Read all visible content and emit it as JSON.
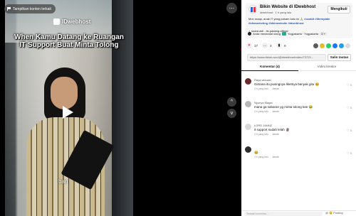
{
  "video": {
    "report_label": "Tampilkan konten terkait",
    "watermark": "IDwebhost",
    "caption_line1": "When Kamu Datang ke Ruangan",
    "caption_line2": "IT Support Buat Minta Tolong",
    "subtitle": "ban",
    "more_label": "...",
    "nav_up": "^",
    "nav_down": "v"
  },
  "account": {
    "name": "Bikin Website di IDwebhost",
    "handle": "idwebhost · 1 h yang lalu",
    "follow_label": "Mengikuti",
    "description_prefix": "Mon maap, anak IT yang paham kalo ini 🙏",
    "description_tags": "#ovabit #ittemplate #idemarketing #bikinwebsite #idwebhost",
    "music": "suara asli - itc.padang.official",
    "collab_label": "Anda menandai ulang",
    "location_label": "Yogyakarta · Yogyakarta",
    "plus_count": "3 +"
  },
  "actions": {
    "likes": "17",
    "comments": "3",
    "bookmarks": "0"
  },
  "link": {
    "url": "https://www.tiktok.com/@idwebhost/video/73723...",
    "copy_label": "Salin tautan"
  },
  "tabs": {
    "comments": "Komentar (4)",
    "creator_videos": "Video kreator"
  },
  "comments": [
    {
      "user": "Raya widuasi",
      "text": "Gimana itu pusingnya liketnya banyak gitu 😂",
      "time": "3 h yang lalu",
      "reply": "Jawab",
      "likes": "0"
    },
    {
      "user": "Nyonya Magel",
      "text": "mana ga sabaran yg minta tolong kan 😂",
      "time": "3 h yang lalu",
      "reply": "Jawab",
      "likes": "0"
    },
    {
      "user": "LORD JANNZ",
      "text": "it support sudah lelah 🗿",
      "time": "3 h yang lalu",
      "reply": "Jawab",
      "likes": "0"
    },
    {
      "user": "",
      "text": "😂",
      "time": "3 h yang lalu",
      "reply": "Jawab",
      "likes": "0"
    }
  ],
  "reply": {
    "placeholder": "Tambah komentar...",
    "icons": "@ 😊 Posting"
  },
  "colors": {
    "panel_bg": "#ffffff",
    "like_red": "#fe2c55",
    "annotation_arrow": "#e0102a"
  }
}
